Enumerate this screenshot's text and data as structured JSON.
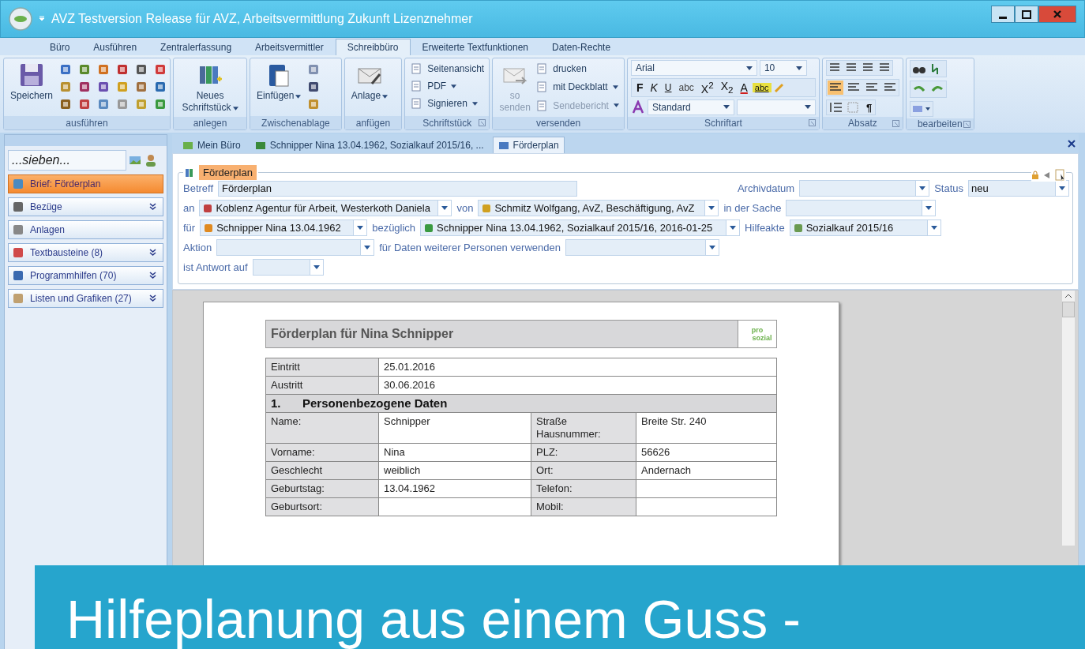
{
  "window": {
    "title": "AVZ Testversion Release für AVZ, Arbeitsvermittlung Zukunft Lizenznehmer"
  },
  "ribbon_tabs": [
    {
      "label": "Büro",
      "selected": false
    },
    {
      "label": "Ausführen",
      "selected": false
    },
    {
      "label": "Zentralerfassung",
      "selected": false
    },
    {
      "label": "Arbeitsvermittler",
      "selected": false
    },
    {
      "label": "Schreibbüro",
      "selected": true
    },
    {
      "label": "Erweiterte Textfunktionen",
      "selected": false
    },
    {
      "label": "Daten-Rechte",
      "selected": false
    }
  ],
  "ribbon_groups": [
    {
      "label": "ausführen",
      "launcher": false,
      "items": [
        {
          "kind": "large",
          "label": "Speichern",
          "menu": false,
          "disabled": false
        },
        {
          "kind": "icons"
        }
      ]
    },
    {
      "label": "anlegen",
      "launcher": false,
      "items": [
        {
          "kind": "large",
          "label": "Neues Schriftstück",
          "menu": true,
          "disabled": false
        }
      ]
    },
    {
      "label": "Zwischenablage",
      "launcher": false,
      "items": [
        {
          "kind": "large",
          "label": "Einfügen",
          "menu": true,
          "disabled": false
        },
        {
          "kind": "icons"
        }
      ]
    },
    {
      "label": "anfügen",
      "launcher": false,
      "items": [
        {
          "kind": "large",
          "label": "Anlage",
          "menu": true,
          "disabled": false
        }
      ]
    },
    {
      "label": "Schriftstück",
      "launcher": true,
      "items": [
        {
          "kind": "small",
          "label": "Seitenansicht",
          "menu": false,
          "disabled": false
        },
        {
          "kind": "small",
          "label": "PDF",
          "menu": true,
          "disabled": false
        },
        {
          "kind": "small",
          "label": "Signieren",
          "menu": true,
          "disabled": false
        }
      ]
    },
    {
      "label": "versenden",
      "launcher": false,
      "items": [
        {
          "kind": "large",
          "label": "so senden",
          "menu": false,
          "disabled": true
        },
        {
          "kind": "small",
          "label": "drucken",
          "menu": false,
          "disabled": false
        },
        {
          "kind": "small",
          "label": "mit Deckblatt",
          "menu": true,
          "disabled": false
        },
        {
          "kind": "small",
          "label": "Sendebericht",
          "menu": true,
          "disabled": true
        }
      ]
    },
    {
      "label": "Schriftart",
      "launcher": true,
      "items": [
        {
          "kind": "font",
          "font": "Arial",
          "size": "10",
          "style": "Standard",
          "buttons": [
            {
              "kind": "bold",
              "label": "F"
            },
            {
              "kind": "italic",
              "label": "K"
            },
            {
              "kind": "underline",
              "label": "U"
            },
            {
              "kind": "strike",
              "label": "abc"
            },
            {
              "kind": "plain",
              "label": "X$^{2}$"
            },
            {
              "kind": "plain",
              "label": "X$_{2}$"
            },
            {
              "kind": "color",
              "label": "A"
            },
            {
              "kind": "highlight",
              "label": "abc"
            }
          ]
        }
      ]
    },
    {
      "label": "Absatz",
      "launcher": true,
      "items": [
        {
          "kind": "paragraph",
          "pilcrow": "¶",
          "align_buttons": [
            {
              "selected": true
            },
            {
              "selected": false
            },
            {
              "selected": false
            },
            {
              "selected": false
            }
          ]
        }
      ]
    },
    {
      "label": "bearbeiten",
      "launcher": true,
      "items": [
        {
          "kind": "edit"
        }
      ]
    }
  ],
  "sidebar": {
    "search": {
      "value": "...sieben..."
    },
    "items": [
      {
        "label": "Brief: Förderplan",
        "selected": true,
        "expandable": false
      },
      {
        "label": "Bezüge",
        "selected": false,
        "expandable": true
      },
      {
        "label": "Anlagen",
        "selected": false,
        "expandable": false
      },
      {
        "label": "Textbausteine (8)",
        "selected": false,
        "expandable": true
      },
      {
        "label": "Programmhilfen (70)",
        "selected": false,
        "expandable": true
      },
      {
        "label": "Listen und Grafiken (27)",
        "selected": false,
        "expandable": true
      }
    ]
  },
  "doc_tabs": [
    {
      "label": "Mein Büro",
      "selected": false
    },
    {
      "label": "Schnipper Nina 13.04.1962, Sozialkauf 2015/16, ...",
      "selected": false
    },
    {
      "label": "Förderplan",
      "selected": true
    }
  ],
  "form": {
    "title": "Förderplan",
    "lines": [
      {
        "fields": [
          {
            "kind": "label",
            "text": "Betreff"
          },
          {
            "kind": "text",
            "value": "Förderplan"
          },
          {
            "kind": "label",
            "text": "Archivdatum"
          },
          {
            "kind": "combo"
          },
          {
            "kind": "label",
            "text": "Status"
          },
          {
            "kind": "combo",
            "value": "neu"
          }
        ]
      },
      {
        "fields": [
          {
            "kind": "label",
            "text": "an"
          },
          {
            "kind": "combo",
            "value": "Koblenz Agentur für Arbeit, Westerkoth Daniela"
          },
          {
            "kind": "label",
            "text": "von"
          },
          {
            "kind": "combo",
            "value": "Schmitz Wolfgang, AvZ, Beschäftigung, AvZ"
          },
          {
            "kind": "label",
            "text": "in der Sache"
          },
          {
            "kind": "combo"
          }
        ]
      },
      {
        "fields": [
          {
            "kind": "label",
            "text": "für"
          },
          {
            "kind": "combo",
            "value": "Schnipper Nina 13.04.1962"
          },
          {
            "kind": "label",
            "text": "bezüglich"
          },
          {
            "kind": "combo",
            "value": "Schnipper Nina 13.04.1962, Sozialkauf 2015/16, 2016-01-25"
          },
          {
            "kind": "label",
            "text": "Hilfeakte"
          },
          {
            "kind": "combo",
            "value": "Sozialkauf 2015/16"
          }
        ]
      },
      {
        "fields": [
          {
            "kind": "label",
            "text": "Aktion"
          },
          {
            "kind": "combo"
          },
          {
            "kind": "label",
            "text": "für Daten weiterer Personen verwenden"
          },
          {
            "kind": "combo"
          }
        ]
      },
      {
        "fields": [
          {
            "kind": "label",
            "text": "ist Antwort auf"
          },
          {
            "kind": "combo"
          }
        ]
      }
    ]
  },
  "document": {
    "heading": "Förderplan für Nina Schnipper",
    "logo": [
      "pro",
      "sozial"
    ],
    "rows": [
      {
        "kind": "pair",
        "label": "Eintritt",
        "value": "25.01.2016"
      },
      {
        "kind": "pair",
        "label": "Austritt",
        "value": "30.06.2016"
      },
      {
        "kind": "section",
        "number": "1.",
        "title": "Personenbezogene Daten"
      },
      {
        "kind": "quad",
        "cells": [
          {
            "label": "Name:",
            "value": "Schnipper"
          },
          {
            "label": "Straße Hausnummer:",
            "value": "Breite Str. 240"
          }
        ]
      },
      {
        "kind": "quad",
        "cells": [
          {
            "label": "Vorname:",
            "value": "Nina"
          },
          {
            "label": "PLZ:",
            "value": "56626"
          }
        ]
      },
      {
        "kind": "quad",
        "cells": [
          {
            "label": "Geschlecht",
            "value": "weiblich"
          },
          {
            "label": "Ort:",
            "value": "Andernach"
          }
        ]
      },
      {
        "kind": "quad",
        "cells": [
          {
            "label": "Geburtstag:",
            "value": "13.04.1962"
          },
          {
            "label": "Telefon:"
          }
        ]
      },
      {
        "kind": "quad",
        "cells": [
          {
            "label": "Geburtsort:"
          },
          {
            "label": "Mobil:"
          }
        ]
      }
    ]
  },
  "banner": {
    "text": "Hilfeplanung aus einem Guss -"
  }
}
